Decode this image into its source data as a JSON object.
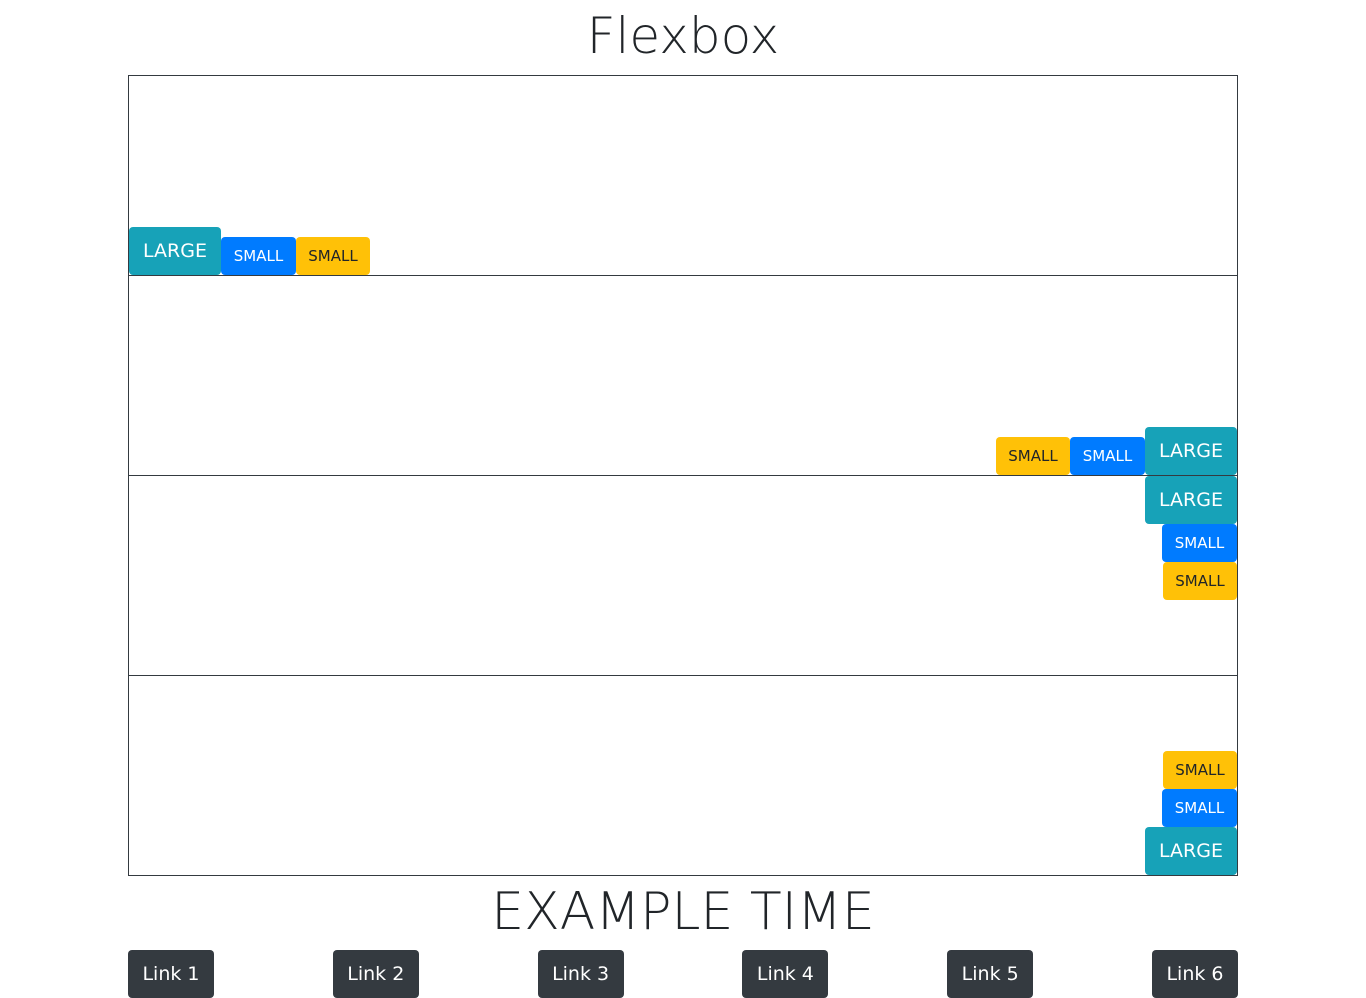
{
  "header": {
    "title": "Flexbox"
  },
  "rows": [
    {
      "large": "LARGE",
      "small_blue": "SMALL",
      "small_yellow": "SMALL"
    },
    {
      "large": "LARGE",
      "small_blue": "SMALL",
      "small_yellow": "SMALL"
    },
    {
      "large": "LARGE",
      "small_blue": "SMALL",
      "small_yellow": "SMALL"
    },
    {
      "large": "LARGE",
      "small_blue": "SMALL",
      "small_yellow": "SMALL"
    }
  ],
  "section": {
    "title": "EXAMPLE TIME"
  },
  "links": [
    {
      "label": "Link 1"
    },
    {
      "label": "Link 2"
    },
    {
      "label": "Link 3"
    },
    {
      "label": "Link 4"
    },
    {
      "label": "Link 5"
    },
    {
      "label": "Link 6"
    }
  ],
  "colors": {
    "large": "#17a2b8",
    "small_blue": "#007bff",
    "small_yellow": "#ffc107",
    "dark": "#343a40"
  }
}
